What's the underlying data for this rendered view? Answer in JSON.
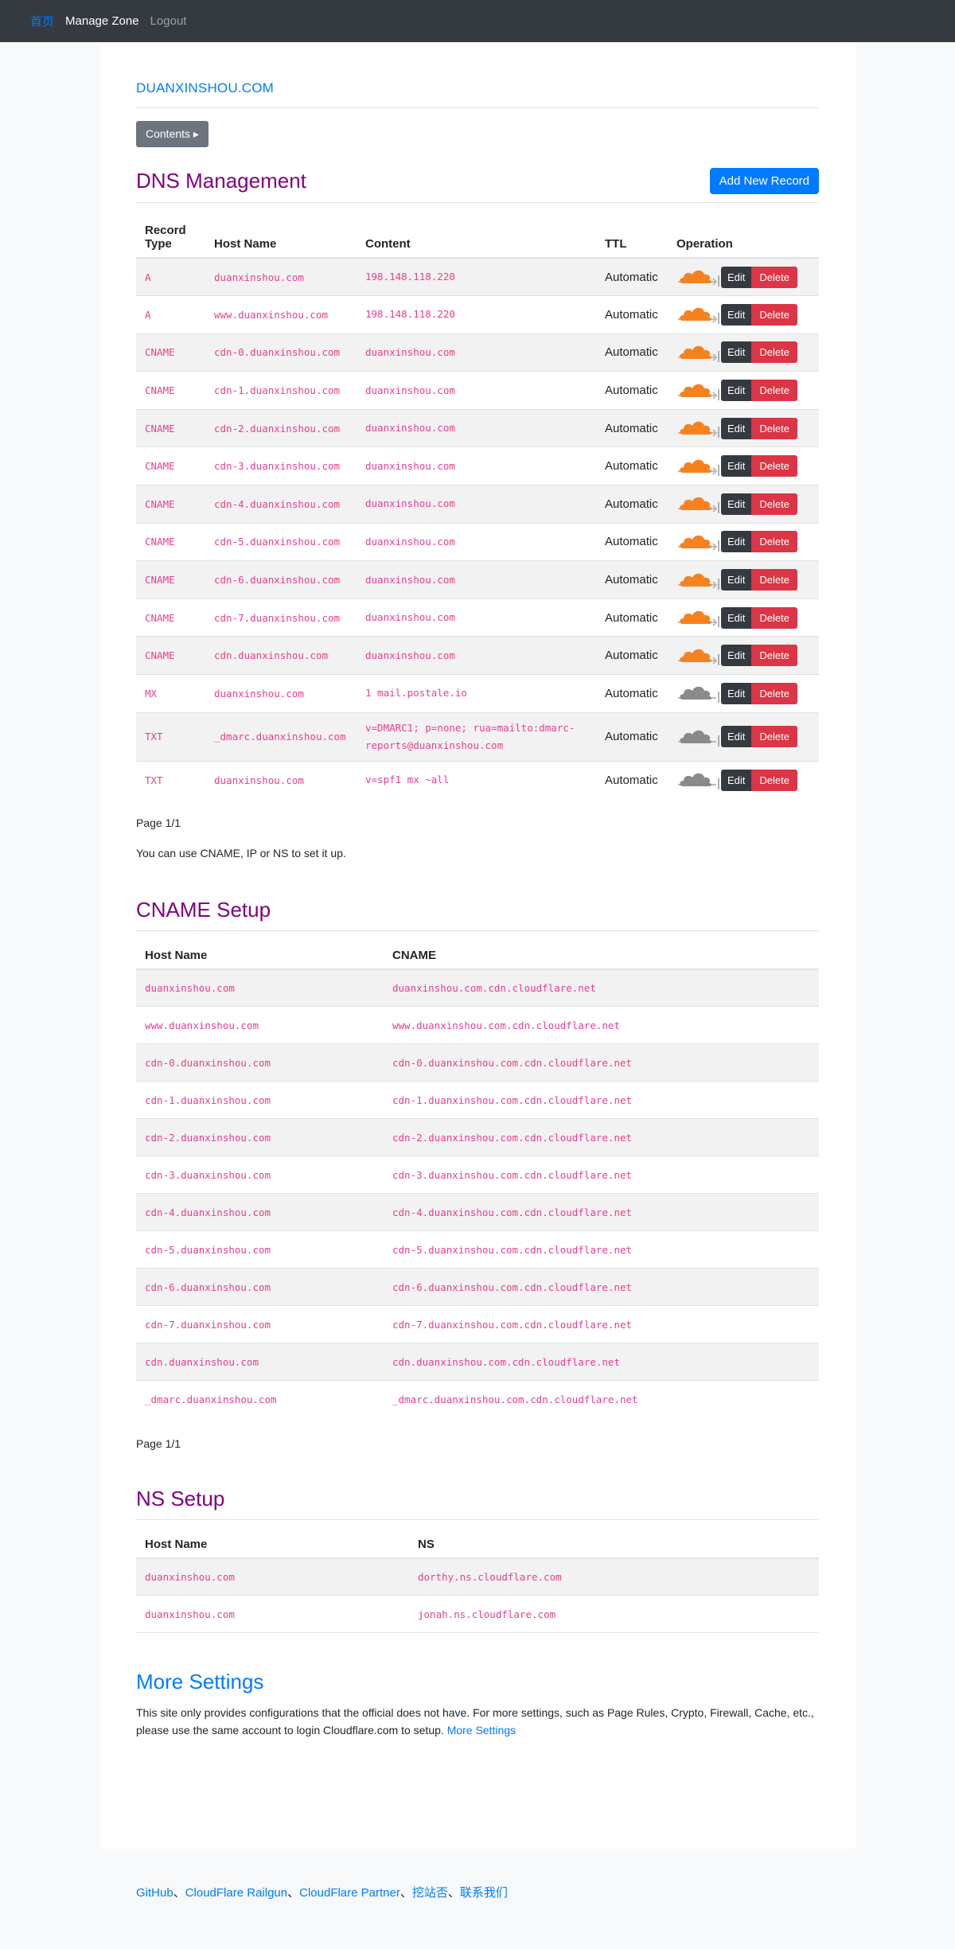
{
  "nav": {
    "home": "首页",
    "manage_zone": "Manage Zone",
    "logout": "Logout"
  },
  "domain": "DUANXINSHOU.COM",
  "contents_button": "Contents ▸",
  "dns": {
    "title": "DNS Management",
    "add_button": "Add New Record",
    "headers": {
      "type": "Record Type",
      "host": "Host Name",
      "content": "Content",
      "ttl": "TTL",
      "operation": "Operation"
    },
    "edit_label": "Edit",
    "delete_label": "Delete",
    "records": [
      {
        "type": "A",
        "host": "duanxinshou.com",
        "content": "198.148.118.220",
        "ttl": "Automatic",
        "proxied": true
      },
      {
        "type": "A",
        "host": "www.duanxinshou.com",
        "content": "198.148.118.220",
        "ttl": "Automatic",
        "proxied": true
      },
      {
        "type": "CNAME",
        "host": "cdn-0.duanxinshou.com",
        "content": "duanxinshou.com",
        "ttl": "Automatic",
        "proxied": true
      },
      {
        "type": "CNAME",
        "host": "cdn-1.duanxinshou.com",
        "content": "duanxinshou.com",
        "ttl": "Automatic",
        "proxied": true
      },
      {
        "type": "CNAME",
        "host": "cdn-2.duanxinshou.com",
        "content": "duanxinshou.com",
        "ttl": "Automatic",
        "proxied": true
      },
      {
        "type": "CNAME",
        "host": "cdn-3.duanxinshou.com",
        "content": "duanxinshou.com",
        "ttl": "Automatic",
        "proxied": true
      },
      {
        "type": "CNAME",
        "host": "cdn-4.duanxinshou.com",
        "content": "duanxinshou.com",
        "ttl": "Automatic",
        "proxied": true
      },
      {
        "type": "CNAME",
        "host": "cdn-5.duanxinshou.com",
        "content": "duanxinshou.com",
        "ttl": "Automatic",
        "proxied": true
      },
      {
        "type": "CNAME",
        "host": "cdn-6.duanxinshou.com",
        "content": "duanxinshou.com",
        "ttl": "Automatic",
        "proxied": true
      },
      {
        "type": "CNAME",
        "host": "cdn-7.duanxinshou.com",
        "content": "duanxinshou.com",
        "ttl": "Automatic",
        "proxied": true
      },
      {
        "type": "CNAME",
        "host": "cdn.duanxinshou.com",
        "content": "duanxinshou.com",
        "ttl": "Automatic",
        "proxied": true
      },
      {
        "type": "MX",
        "host": "duanxinshou.com",
        "content": "1 mail.postale.io",
        "ttl": "Automatic",
        "proxied": false
      },
      {
        "type": "TXT",
        "host": "_dmarc.duanxinshou.com",
        "content": "v=DMARC1; p=none; rua=mailto:dmarc-reports@duanxinshou.com",
        "ttl": "Automatic",
        "proxied": false
      },
      {
        "type": "TXT",
        "host": "duanxinshou.com",
        "content": "v=spf1 mx ~all",
        "ttl": "Automatic",
        "proxied": false
      }
    ],
    "page": "Page 1/1",
    "hint": "You can use CNAME, IP or NS to set it up."
  },
  "cname": {
    "title": "CNAME Setup",
    "headers": {
      "host": "Host Name",
      "cname": "CNAME"
    },
    "rows": [
      {
        "host": "duanxinshou.com",
        "cname": "duanxinshou.com.cdn.cloudflare.net"
      },
      {
        "host": "www.duanxinshou.com",
        "cname": "www.duanxinshou.com.cdn.cloudflare.net"
      },
      {
        "host": "cdn-0.duanxinshou.com",
        "cname": "cdn-0.duanxinshou.com.cdn.cloudflare.net"
      },
      {
        "host": "cdn-1.duanxinshou.com",
        "cname": "cdn-1.duanxinshou.com.cdn.cloudflare.net"
      },
      {
        "host": "cdn-2.duanxinshou.com",
        "cname": "cdn-2.duanxinshou.com.cdn.cloudflare.net"
      },
      {
        "host": "cdn-3.duanxinshou.com",
        "cname": "cdn-3.duanxinshou.com.cdn.cloudflare.net"
      },
      {
        "host": "cdn-4.duanxinshou.com",
        "cname": "cdn-4.duanxinshou.com.cdn.cloudflare.net"
      },
      {
        "host": "cdn-5.duanxinshou.com",
        "cname": "cdn-5.duanxinshou.com.cdn.cloudflare.net"
      },
      {
        "host": "cdn-6.duanxinshou.com",
        "cname": "cdn-6.duanxinshou.com.cdn.cloudflare.net"
      },
      {
        "host": "cdn-7.duanxinshou.com",
        "cname": "cdn-7.duanxinshou.com.cdn.cloudflare.net"
      },
      {
        "host": "cdn.duanxinshou.com",
        "cname": "cdn.duanxinshou.com.cdn.cloudflare.net"
      },
      {
        "host": "_dmarc.duanxinshou.com",
        "cname": "_dmarc.duanxinshou.com.cdn.cloudflare.net"
      }
    ],
    "page": "Page 1/1"
  },
  "ns": {
    "title": "NS Setup",
    "headers": {
      "host": "Host Name",
      "ns": "NS"
    },
    "rows": [
      {
        "host": "duanxinshou.com",
        "ns": "dorthy.ns.cloudflare.com"
      },
      {
        "host": "duanxinshou.com",
        "ns": "jonah.ns.cloudflare.com"
      }
    ]
  },
  "more": {
    "title": "More Settings",
    "text": "This site only provides configurations that the official does not have. For more settings, such as Page Rules, Crypto, Firewall, Cache, etc., please use the same account to login Cloudflare.com to setup.",
    "link": "More Settings"
  },
  "footer": {
    "links": [
      "GitHub",
      "CloudFlare Railgun",
      "CloudFlare Partner",
      "挖站否",
      "联系我们"
    ],
    "separator": "、"
  },
  "colors": {
    "accent": "#007bff",
    "heading": "#800080",
    "code": "#e83e8c",
    "cloud_on": "#f6821f",
    "cloud_off": "#8a8a8a"
  },
  "icons": {
    "proxied": "cloud-orange-icon",
    "dns_only": "cloud-gray-icon"
  }
}
